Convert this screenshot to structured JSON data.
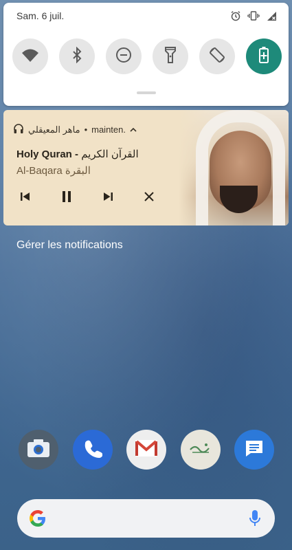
{
  "status": {
    "date": "Sam. 6 juil.",
    "icons": [
      "alarm-icon",
      "vibrate-icon",
      "signal-off-icon"
    ]
  },
  "quick_settings": {
    "tiles": [
      {
        "name": "wifi-icon",
        "active": false
      },
      {
        "name": "bluetooth-icon",
        "active": false
      },
      {
        "name": "do-not-disturb-icon",
        "active": false
      },
      {
        "name": "flashlight-icon",
        "active": false
      },
      {
        "name": "auto-rotate-icon",
        "active": false
      },
      {
        "name": "battery-saver-icon",
        "active": true
      }
    ],
    "accent": "#1e8a7a"
  },
  "media": {
    "app_name": "ماهر المعيقلي",
    "separator": "•",
    "status": "mainten.",
    "title_en": "Holy Quran",
    "title_dash": " - ",
    "title_ar": "القرآن الكريم",
    "subtitle_en": "Al-Baqara",
    "subtitle_ar": "البقرة"
  },
  "manage_label": "Gérer les notifications",
  "dock": {
    "apps": [
      "camera-icon",
      "phone-icon",
      "gmail-icon",
      "quran-app-icon",
      "messages-icon"
    ]
  },
  "search": {
    "logo": "google-icon",
    "mic": "mic-icon"
  }
}
